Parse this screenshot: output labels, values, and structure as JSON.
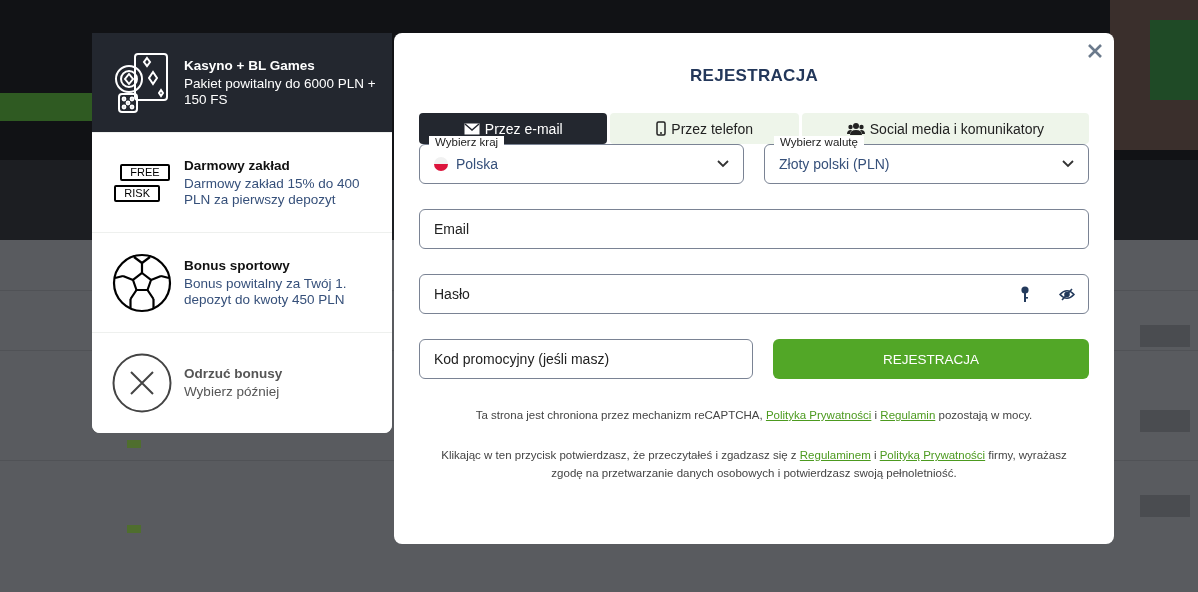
{
  "offers": [
    {
      "kind": "casino",
      "title": "Kasyno + BL Games",
      "description": "Pakiet powitalny do 6000 PLN + 150 FS",
      "selected": true
    },
    {
      "kind": "freebet",
      "title": "Darmowy zakład",
      "description": "Darmowy zakład 15% do 400 PLN za pierwszy depozyt",
      "badge_lines": [
        "FREE",
        "RISK"
      ],
      "selected": false
    },
    {
      "kind": "sport",
      "title": "Bonus sportowy",
      "description": "Bonus powitalny za Twój 1. depozyt do kwoty 450 PLN",
      "selected": false
    },
    {
      "kind": "decline",
      "title": "Odrzuć bonusy",
      "description": "Wybierz później",
      "selected": false
    }
  ],
  "dialog": {
    "title": "REJESTRACJA",
    "tabs": [
      {
        "kind": "email",
        "label": "Przez e-mail",
        "selected": true
      },
      {
        "kind": "phone",
        "label": "Przez telefon",
        "selected": false
      },
      {
        "kind": "social",
        "label": "Social media i komunikatory",
        "selected": false
      }
    ],
    "country": {
      "label": "Wybierz kraj",
      "value": "Polska"
    },
    "currency": {
      "label": "Wybierz walutę",
      "value": "Złoty polski (PLN)"
    },
    "email": {
      "placeholder": "Email"
    },
    "password": {
      "placeholder": "Hasło"
    },
    "promo": {
      "placeholder": "Kod promocyjny (jeśli masz)"
    },
    "submit": "REJESTRACJA",
    "notes": [
      [
        {
          "text": "Ta strona jest chroniona przez mechanizm reCAPTCHA, "
        },
        {
          "link": "Polityka Prywatności"
        },
        {
          "text": " i "
        },
        {
          "link": "Regulamin"
        },
        {
          "text": " pozostają w mocy."
        }
      ],
      [
        {
          "text": "Klikając w ten przycisk potwierdzasz, że przeczytałeś i zgadzasz się z "
        },
        {
          "link": "Regulaminem"
        },
        {
          "text": " i "
        },
        {
          "link": "Polityką Prywatności"
        },
        {
          "text": " firmy, wyrażasz zgodę na przetwarzanie danych osobowych i potwierdzasz swoją pełnoletniość."
        }
      ]
    ]
  }
}
